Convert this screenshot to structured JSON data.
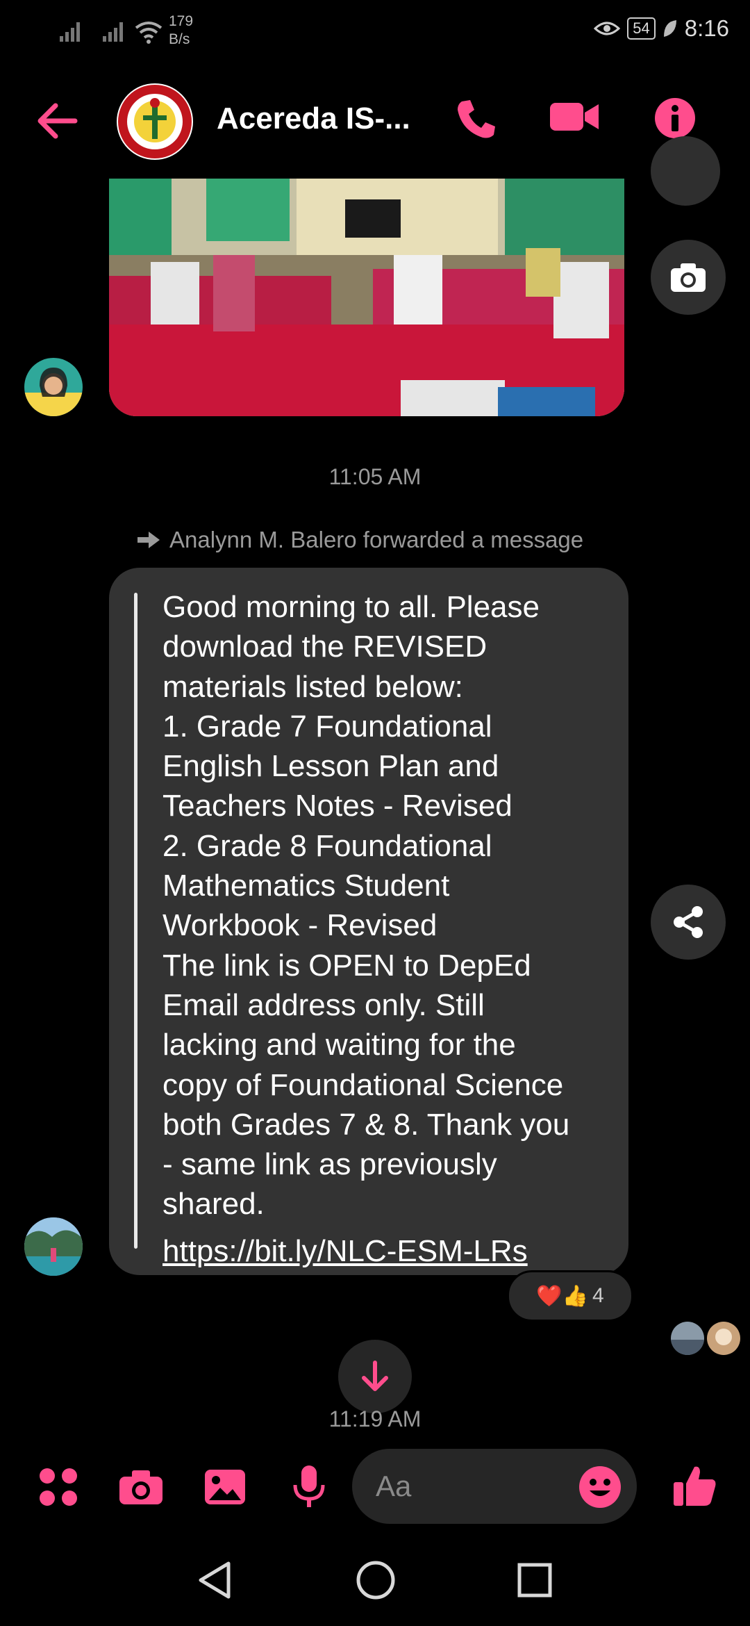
{
  "status_bar": {
    "net_speed_value": "179",
    "net_speed_unit": "B/s",
    "battery": "54",
    "time": "8:16"
  },
  "header": {
    "title": "Acereda IS-..."
  },
  "messages": {
    "timestamp_1": "11:05 AM",
    "forward_note": "Analynn M. Balero forwarded a message",
    "forwarded_text": "Good morning to all. Please\ndownload the REVISED\nmaterials listed below:\n1.  Grade 7 Foundational\nEnglish Lesson Plan and\nTeachers Notes - Revised\n2.  Grade 8 Foundational\nMathematics Student\nWorkbook - Revised\nThe link is OPEN to DepEd\nEmail address only. Still\nlacking and waiting for the\ncopy of Foundational Science\nboth Grades 7 & 8. Thank you\n- same link as previously\nshared.",
    "link": "https://bit.ly/NLC-ESM-LRs",
    "reactions": {
      "emojis": "❤️👍",
      "count": "4"
    },
    "timestamp_2": "11:19 AM"
  },
  "composer": {
    "placeholder": "Aa"
  },
  "colors": {
    "accent": "#ff4d8d",
    "background": "#000000",
    "bubble": "#333333",
    "secondary_text": "#9a9a9a"
  }
}
